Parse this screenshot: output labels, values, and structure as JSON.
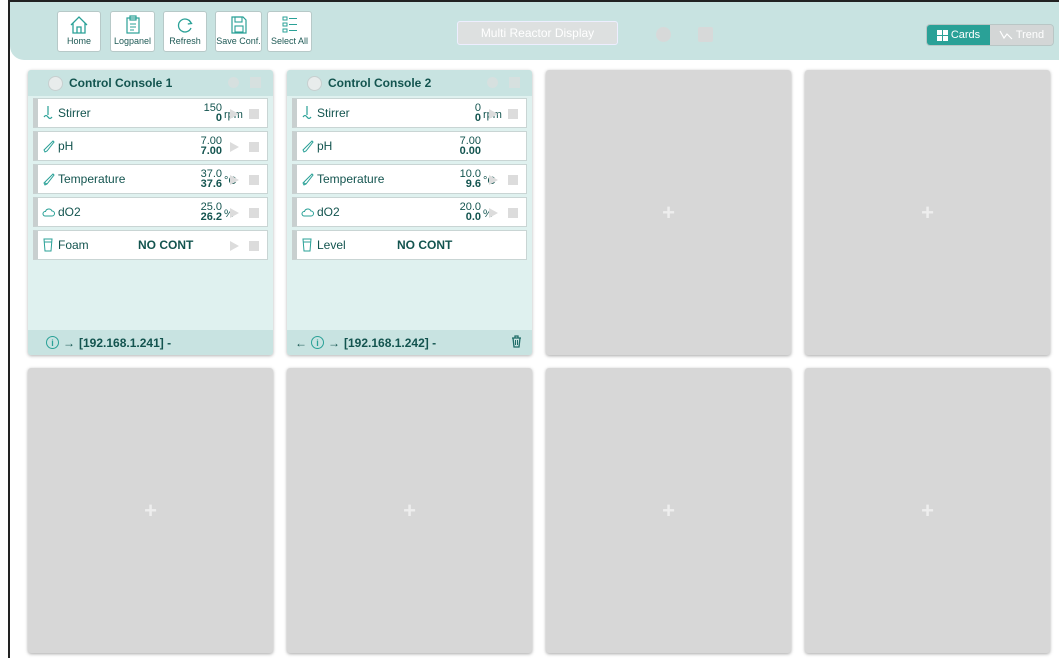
{
  "toolbar": {
    "buttons": [
      {
        "label": "Home",
        "icon": "home-icon"
      },
      {
        "label": "Logpanel",
        "icon": "clipboard-icon"
      },
      {
        "label": "Refresh",
        "icon": "refresh-icon"
      },
      {
        "label": "Save Conf.",
        "icon": "save-icon"
      },
      {
        "label": "Select All",
        "icon": "checklist-icon"
      }
    ],
    "title": "Multi Reactor Display",
    "views": {
      "cards": "Cards",
      "trend": "Trend",
      "active": "Cards"
    }
  },
  "consoles": [
    {
      "name": "Control Console 1",
      "rows": [
        {
          "label": "Stirrer",
          "icon": "stirrer-icon",
          "setpoint": "150",
          "value": "0",
          "unit": "rpm",
          "controls": true
        },
        {
          "label": "pH",
          "icon": "probe-icon",
          "setpoint": "7.00",
          "value": "7.00",
          "unit": "",
          "controls": true
        },
        {
          "label": "Temperature",
          "icon": "thermo-probe-icon",
          "setpoint": "37.0",
          "value": "37.6",
          "unit": "°C",
          "controls": true
        },
        {
          "label": "dO2",
          "icon": "cloud-icon",
          "setpoint": "25.0",
          "value": "26.2",
          "unit": "%",
          "controls": true
        },
        {
          "label": "Foam",
          "icon": "foam-icon",
          "status": "NO CONT",
          "controls": true
        }
      ],
      "footer": {
        "address": "[192.168.1.241] -",
        "has_left_arrow": false,
        "has_trash": false
      }
    },
    {
      "name": "Control Console 2",
      "rows": [
        {
          "label": "Stirrer",
          "icon": "stirrer-icon",
          "setpoint": "0",
          "value": "0",
          "unit": "rpm",
          "controls": true
        },
        {
          "label": "pH",
          "icon": "probe-icon",
          "setpoint": "7.00",
          "value": "0.00",
          "unit": "",
          "controls": false
        },
        {
          "label": "Temperature",
          "icon": "thermo-probe-icon",
          "setpoint": "10.0",
          "value": "9.6",
          "unit": "°C",
          "controls": true
        },
        {
          "label": "dO2",
          "icon": "cloud-icon",
          "setpoint": "20.0",
          "value": "0.0",
          "unit": "%",
          "controls": true
        },
        {
          "label": "Level",
          "icon": "level-icon",
          "status": "NO CONT",
          "controls": false
        }
      ],
      "footer": {
        "address": "[192.168.1.242] -",
        "has_left_arrow": true,
        "has_trash": true
      }
    }
  ],
  "empty_slot_symbol": "+",
  "colors": {
    "accent": "#2aa197",
    "panel": "#c8e3e1",
    "card_body": "#dff1ef",
    "empty": "#d7d7d7"
  }
}
